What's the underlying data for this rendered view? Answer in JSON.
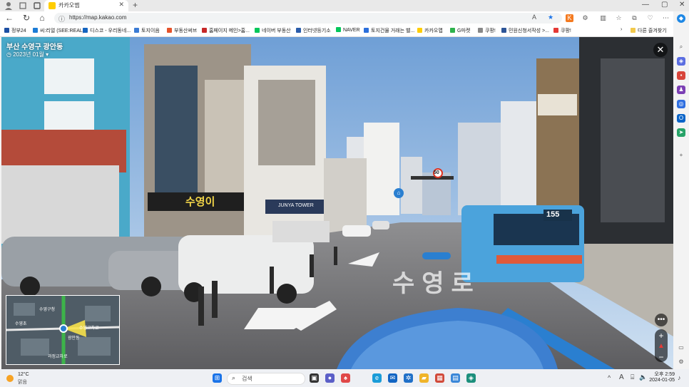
{
  "browser": {
    "tab_title": "카카오맵",
    "url": "https://map.kakao.com"
  },
  "bookmarks": [
    {
      "label": "정부24",
      "color": "#1d4fa3"
    },
    {
      "label": "씨:리얼 (SEE:REAL)",
      "color": "#1c7cd6"
    },
    {
      "label": "디스코 - 우리동네...",
      "color": "#1565c0"
    },
    {
      "label": "토지이음",
      "color": "#3b7bd4"
    },
    {
      "label": "부동산써브",
      "color": "#e5532a"
    },
    {
      "label": "홈페이지 메인>홈...",
      "color": "#c62828"
    },
    {
      "label": "네이버 부동산",
      "color": "#03c75a"
    },
    {
      "label": "인터넷등기소",
      "color": "#2a5caa"
    },
    {
      "label": "NAVER",
      "color": "#03c75a"
    },
    {
      "label": "토지건물 거래는 밸...",
      "color": "#2b6fdb"
    },
    {
      "label": "카카오맵",
      "color": "#ffcd00"
    },
    {
      "label": "G마켓",
      "color": "#2eb24c"
    },
    {
      "label": "쿠팡!",
      "color": "#888888"
    },
    {
      "label": "민원신청서작성 >...",
      "color": "#2d5597"
    },
    {
      "label": "쿠팡!",
      "color": "#e53935"
    }
  ],
  "bookmarks_more": "다른 즐겨찾기",
  "roadview": {
    "location": "부산 수영구 광안동",
    "date": "2023년 01월",
    "sign_store": "수영이",
    "sign_building": "JUNYA TOWER",
    "road_marking": "수영로",
    "bus_number": "155",
    "speed_limit": "50",
    "minimap": {
      "tag1": "수영구청",
      "tag2": "수영교차로",
      "tag3": "광안동",
      "tag4": "수영초",
      "tag5": "과정교차로"
    }
  },
  "taskbar": {
    "temperature": "12°C",
    "condition": "맑음",
    "search_placeholder": "검색",
    "time": "오후 2:59",
    "date": "2024-01-05"
  }
}
